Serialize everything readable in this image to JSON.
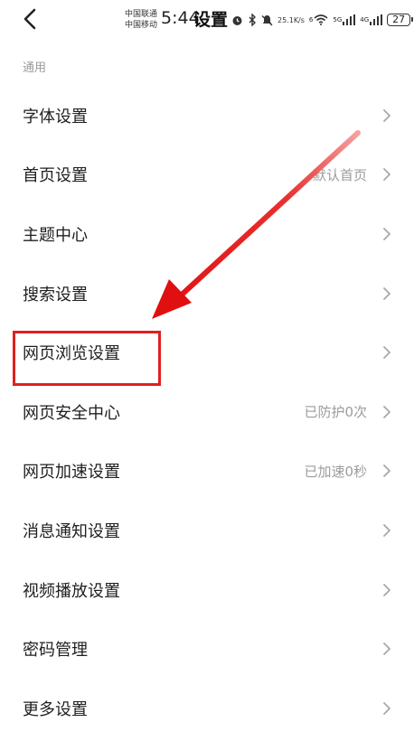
{
  "status_bar": {
    "carrier_1": "中国联通",
    "carrier_2": "中国移动",
    "time": "5:44",
    "net_speed_value": "25.1",
    "net_speed_unit": "K/s",
    "wifi_tag": "6",
    "sig1_tag": "5G",
    "sig2_tag": "4G",
    "battery": "27",
    "icons": [
      "alarm-icon",
      "bluetooth-icon",
      "mute-icon",
      "wifi-icon",
      "signal-5g-icon",
      "signal-4g-icon",
      "battery-icon"
    ]
  },
  "header": {
    "title": "设置",
    "back_icon": "chevron-left-icon"
  },
  "section": {
    "label": "通用"
  },
  "items": [
    {
      "label": "字体设置",
      "value": ""
    },
    {
      "label": "首页设置",
      "value": "默认首页"
    },
    {
      "label": "主题中心",
      "value": ""
    },
    {
      "label": "搜索设置",
      "value": ""
    },
    {
      "label": "网页浏览设置",
      "value": ""
    },
    {
      "label": "网页安全中心",
      "value": "已防护0次"
    },
    {
      "label": "网页加速设置",
      "value": "已加速0秒"
    },
    {
      "label": "消息通知设置",
      "value": ""
    },
    {
      "label": "视频播放设置",
      "value": ""
    },
    {
      "label": "密码管理",
      "value": ""
    },
    {
      "label": "更多设置",
      "value": ""
    }
  ],
  "annotation": {
    "color": "#e02020",
    "highlighted_item": "网页浏览设置"
  }
}
